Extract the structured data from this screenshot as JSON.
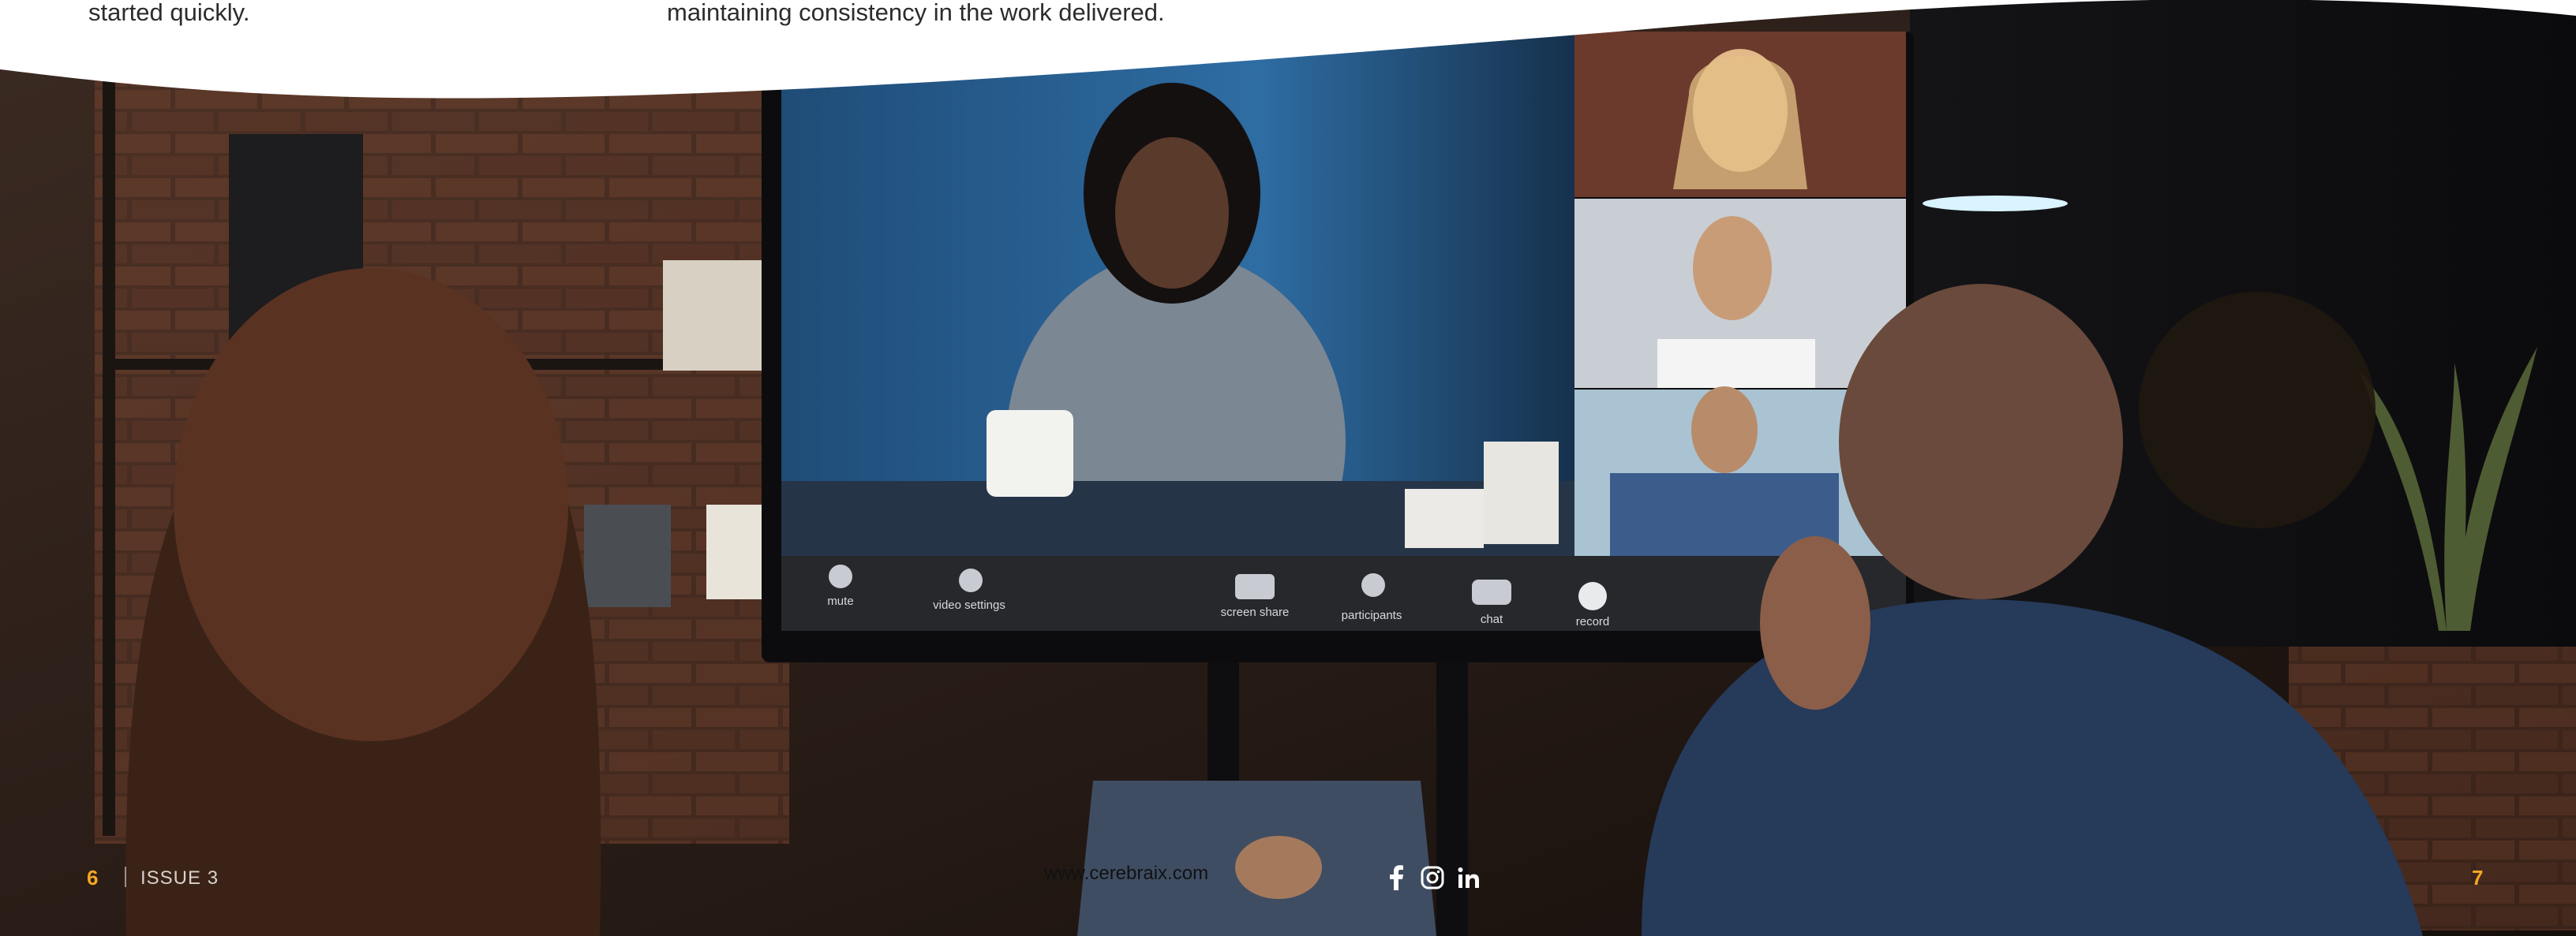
{
  "page": {
    "top_text_left": "started quickly.",
    "top_text_mid": "maintaining consistency in the work delivered."
  },
  "conference_ui": {
    "buttons": [
      "mute",
      "video settings",
      "screen share",
      "participants",
      "chat",
      "record"
    ]
  },
  "footer": {
    "page_left": "6",
    "issue": "ISSUE 3",
    "website": "www.cerebraix.com",
    "page_right": "7",
    "social_icons": [
      "facebook-icon",
      "instagram-icon",
      "linkedin-icon"
    ]
  },
  "colors": {
    "accent": "#f5a623",
    "text_dark": "#2c2c2c",
    "background_white": "#ffffff"
  }
}
